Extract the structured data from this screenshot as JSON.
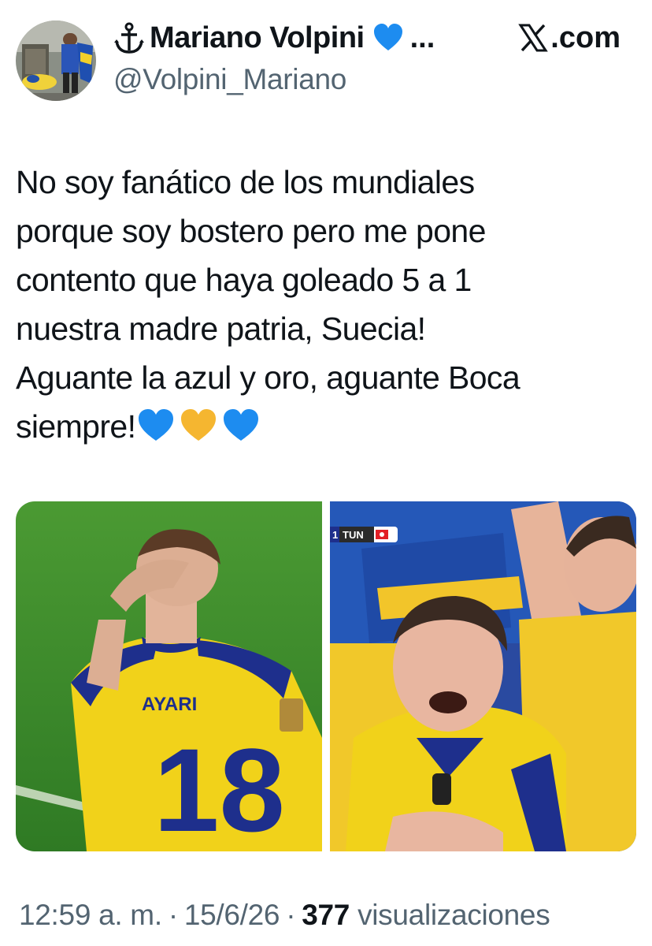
{
  "tweet": {
    "author": {
      "display_name": "Mariano Volpini",
      "ellipsis": "...",
      "handle": "@Volpini_Mariano",
      "name_prefix_icon": "anchor-icon",
      "name_suffix_icon": "blue-heart-icon"
    },
    "brand": {
      "icon": "x-logo-icon",
      "label": ".com"
    },
    "text": "No soy fanático de los mundiales\nporque soy bostero pero me pone\ncontento que haya goleado 5 a 1\nnuestra madre patria, Suecia!\nAguante la azul y oro, aguante Boca\nsiempre!",
    "text_emojis": [
      "blue-heart-icon",
      "yellow-heart-icon",
      "blue-heart-icon"
    ],
    "media": [
      {
        "description_icon": "player-photo",
        "jersey_name": "AYARI",
        "jersey_number": "18"
      },
      {
        "description_icon": "fans-celebration-photo",
        "scoreboard_text": "TUN",
        "scoreboard_digit": "1"
      }
    ],
    "footer": {
      "time": "12:59 a. m.",
      "date": "15/6/26",
      "views_count": "377",
      "views_label": "visualizaciones",
      "separator": "·"
    }
  },
  "colors": {
    "text_primary": "#0f1419",
    "text_secondary": "#536471",
    "heart_blue": "#1d8cf0",
    "heart_yellow": "#f5b630",
    "pitch_green": "#3f8c2e",
    "jersey_yellow": "#f1d21a",
    "jersey_blue": "#1e2f8c"
  }
}
